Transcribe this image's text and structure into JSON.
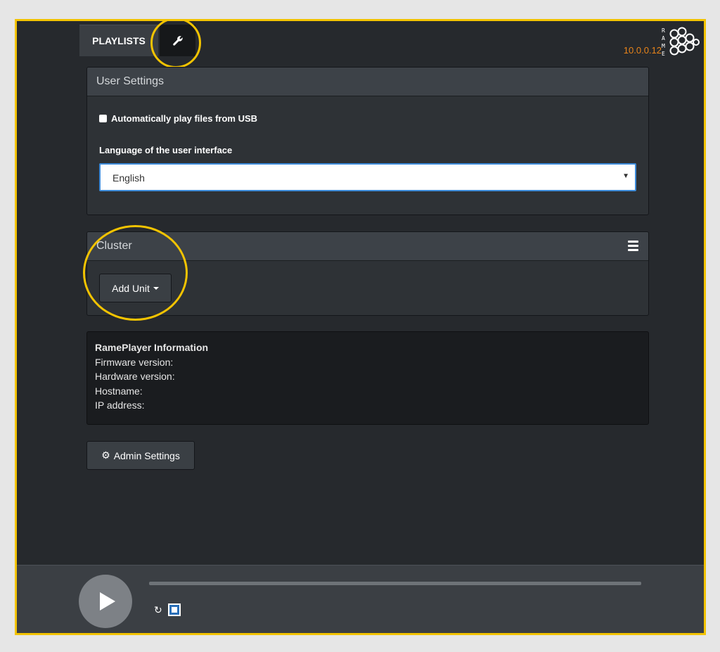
{
  "nav": {
    "playlists_label": "PLAYLISTS",
    "settings_icon": "wrench-icon"
  },
  "header": {
    "ip_address": "10.0.0.12",
    "logo_text": "RAME"
  },
  "user_settings": {
    "title": "User Settings",
    "autoplay_label": "Automatically play files from USB",
    "autoplay_checked": false,
    "language_label": "Language of the user interface",
    "language_value": "English"
  },
  "cluster": {
    "title": "Cluster",
    "add_unit_label": "Add Unit"
  },
  "info": {
    "title": "RamePlayer Information",
    "firmware_label": "Firmware version:",
    "hardware_label": "Hardware version:",
    "hostname_label": "Hostname:",
    "ip_label": "IP address:"
  },
  "admin": {
    "button_label": "Admin Settings"
  },
  "player": {
    "progress_fraction": 0
  },
  "colors": {
    "highlight": "#f2c300",
    "ip_text": "#e8841a",
    "select_border": "#3d8bd9"
  }
}
